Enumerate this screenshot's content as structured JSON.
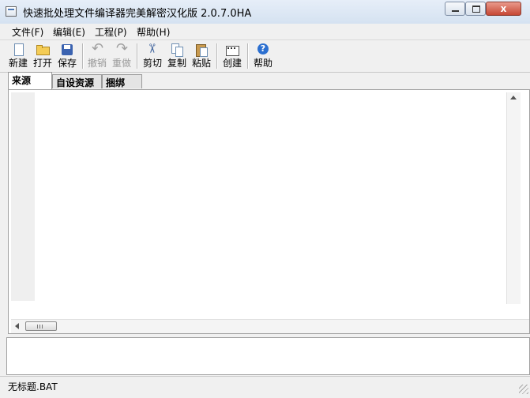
{
  "window": {
    "title": "快速批处理文件编译器完美解密汉化版 2.0.7.0HA",
    "close_label": "x"
  },
  "menu": [
    "文件(F)",
    "编辑(E)",
    "工程(P)",
    "帮助(H)"
  ],
  "toolbar": {
    "new": {
      "label": "新建",
      "icon": "new-file-icon"
    },
    "open": {
      "label": "打开",
      "icon": "folder-open-icon"
    },
    "save": {
      "label": "保存",
      "icon": "floppy-save-icon"
    },
    "undo": {
      "label": "撤销",
      "icon": "undo-icon",
      "disabled": true
    },
    "redo": {
      "label": "重做",
      "icon": "redo-icon",
      "disabled": true
    },
    "cut": {
      "label": "剪切",
      "icon": "scissors-icon"
    },
    "copy": {
      "label": "复制",
      "icon": "copy-icon"
    },
    "paste": {
      "label": "粘贴",
      "icon": "paste-icon"
    },
    "build": {
      "label": "创建",
      "icon": "build-icon"
    },
    "help": {
      "label": "帮助",
      "icon": "help-icon"
    }
  },
  "tabs": [
    "来源",
    "自设资源",
    "捆绑"
  ],
  "editor": {
    "content": ""
  },
  "status": {
    "filename": "无标题.BAT"
  },
  "colors": {
    "titlebar": "#dce7f4",
    "close_button": "#c74734",
    "chrome": "#f0f0f0"
  }
}
